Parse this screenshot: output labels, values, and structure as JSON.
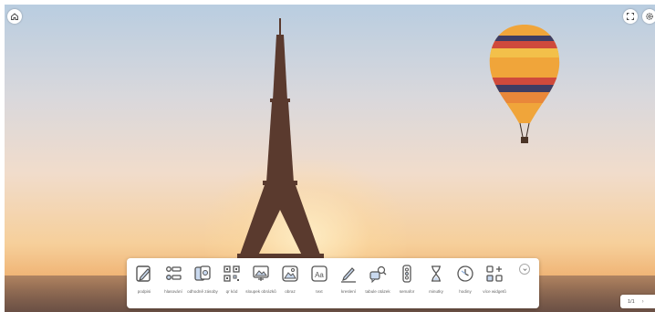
{
  "toolbar": {
    "tools": [
      {
        "label": "podpisi",
        "icon": "signature-icon"
      },
      {
        "label": "hlasování",
        "icon": "poll-icon"
      },
      {
        "label": "odhodně zásoby",
        "icon": "cards-icon"
      },
      {
        "label": "qr kód",
        "icon": "qr-code-icon"
      },
      {
        "label": "sloupek obrázků",
        "icon": "image-gallery-icon"
      },
      {
        "label": "obraz",
        "icon": "image-icon"
      },
      {
        "label": "text",
        "icon": "text-icon"
      },
      {
        "label": "kreslení",
        "icon": "pen-icon"
      },
      {
        "label": "tabule otázek",
        "icon": "question-board-icon"
      },
      {
        "label": "semafor",
        "icon": "traffic-light-icon"
      },
      {
        "label": "minutky",
        "icon": "hourglass-icon"
      },
      {
        "label": "hodiny",
        "icon": "clock-icon"
      },
      {
        "label": "více widgetů",
        "icon": "more-widgets-icon"
      }
    ]
  },
  "pager": {
    "current": "1/1"
  },
  "icons": {
    "home": "home-icon",
    "fullscreen": "fullscreen-icon",
    "settings": "gear-icon",
    "collapse": "chevron-down-icon"
  }
}
